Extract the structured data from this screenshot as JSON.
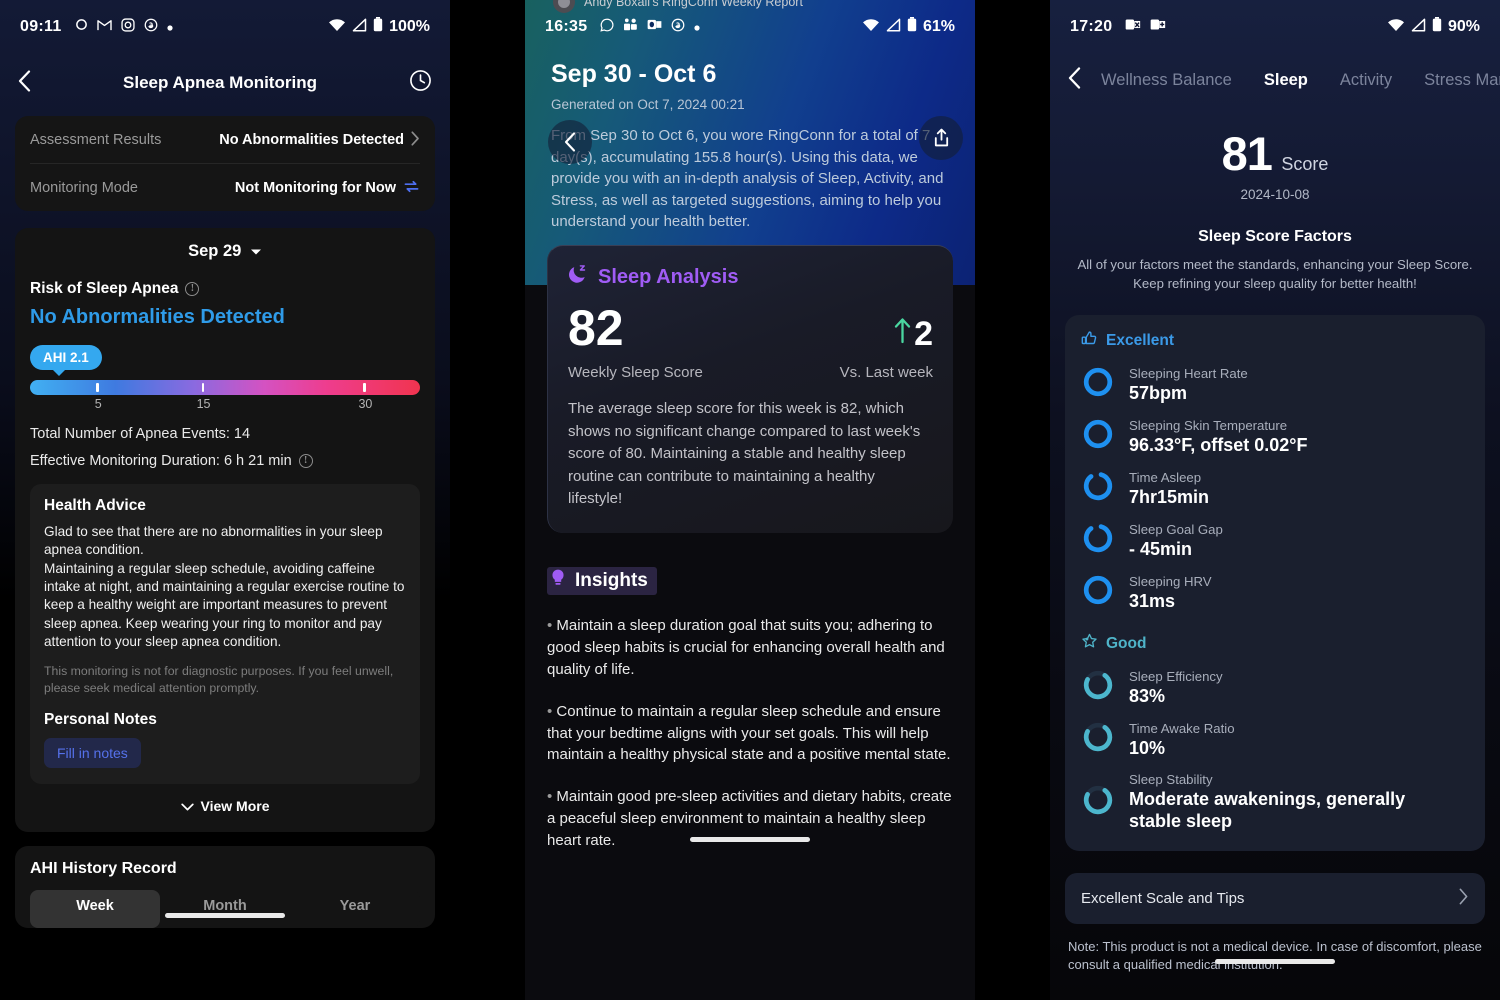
{
  "panel1": {
    "status": {
      "time": "09:11",
      "battery": "100%",
      "icons": [
        "circle-icon",
        "gmail-icon",
        "instagram-icon",
        "threads-icon",
        "dot-icon"
      ]
    },
    "nav": {
      "back": "‹",
      "title": "Sleep Apnea Monitoring",
      "right_icon": "clock-icon"
    },
    "summary_rows": [
      {
        "label": "Assessment Results",
        "value": "No Abnormalities Detected",
        "icon": "chevron-right-icon"
      },
      {
        "label": "Monitoring Mode",
        "value": "Not Monitoring for Now",
        "icon": "sync-icon"
      }
    ],
    "date_picker": "Sep 29",
    "risk_label": "Risk of Sleep Apnea",
    "risk_value": "No Abnormalities Detected",
    "ahi_badge": "AHI 2.1",
    "scale_ticks": [
      "5",
      "15",
      "30"
    ],
    "total_events": "Total Number of Apnea Events: 14",
    "duration": "Effective Monitoring Duration: 6 h 21 min",
    "advice_title": "Health Advice",
    "advice_body": "Glad to see that there are no abnormalities in your sleep apnea condition.\nMaintaining a regular sleep schedule, avoiding caffeine intake at night, and maintaining a regular exercise routine to keep a healthy weight are important measures to prevent sleep apnea. Keep wearing your ring to monitor and pay attention to your sleep apnea condition.",
    "disclaimer": "This monitoring is not for diagnostic purposes. If you feel unwell, please seek medical attention promptly.",
    "personal_notes_title": "Personal Notes",
    "fill_notes_button": "Fill in notes",
    "view_more": "View More",
    "history_title": "AHI History Record",
    "history_tabs": [
      "Week",
      "Month",
      "Year"
    ],
    "history_tab_active": "Week",
    "colors": {
      "accent_blue": "#2f9be8",
      "badge_blue": "#34a8ef",
      "notes_blue": "#5571ea"
    }
  },
  "panel2": {
    "notification": "Andy Boxall's RingConn Weekly Report",
    "status": {
      "time": "16:35",
      "battery": "61%",
      "icons": [
        "whatsapp-icon",
        "teams-icon",
        "outlook-icon",
        "threads-icon",
        "dot-icon"
      ]
    },
    "back_icon": "chevron-left-icon",
    "share_icon": "share-icon",
    "date_range": "Sep 30 - Oct 6",
    "generated": "Generated on Oct 7, 2024 00:21",
    "intro": "From Sep 30 to Oct 6, you wore RingConn for a total of 7 day(s), accumulating 155.8 hour(s). Using this data, we provide you with an in-depth analysis of Sleep, Activity, and Stress, as well as targeted suggestions, aiming to help you understand your health better.",
    "sleep_analysis": {
      "title": "Sleep Analysis",
      "icon": "moon-zzz-icon",
      "score": "82",
      "score_label": "Weekly Sleep Score",
      "delta": "2",
      "delta_icon": "arrow-up-icon",
      "delta_label": "Vs. Last week",
      "body": "The average sleep score for this week is 82, which shows no significant change compared to last week's score of 80. Maintaining a stable and healthy sleep routine can contribute to maintaining a healthy lifestyle!"
    },
    "insights": {
      "title": "Insights",
      "icon": "lightbulb-icon",
      "items": [
        "Maintain a sleep duration goal that suits you; adhering to good sleep habits is crucial for enhancing overall health and quality of life.",
        "Continue to maintain a regular sleep schedule and ensure that your bedtime aligns with your set goals. This will help maintain a healthy physical state and a positive mental state.",
        "Maintain good pre-sleep activities and dietary habits, create a peaceful sleep environment to maintain a healthy sleep heart rate."
      ]
    },
    "colors": {
      "purple": "#a05cf5",
      "green": "#4ad6a0"
    }
  },
  "panel3": {
    "status": {
      "time": "17:20",
      "battery": "90%",
      "icons": [
        "outlook-calendar-icon",
        "outlook-mail-icon"
      ]
    },
    "back_icon": "chevron-left-icon",
    "tabs": [
      "Wellness Balance",
      "Sleep",
      "Activity",
      "Stress Mar"
    ],
    "tab_active": "Sleep",
    "score": "81",
    "score_word": "Score",
    "score_date": "2024-10-08",
    "factors_title": "Sleep Score Factors",
    "factors_sub": "All of your factors meet the standards, enhancing your Sleep Score. Keep refining your sleep quality for better health!",
    "groups": [
      {
        "name": "Excellent",
        "icon": "thumbs-up-icon",
        "color": "#3b9ae8",
        "ring_color": "#1e90f0",
        "items": [
          {
            "label": "Sleeping Heart Rate",
            "value": "57bpm",
            "ring_pct": 100
          },
          {
            "label": "Sleeping Skin Temperature",
            "value": "96.33°F, offset 0.02°F",
            "ring_pct": 100
          },
          {
            "label": "Time Asleep",
            "value": "7hr15min",
            "ring_pct": 85
          },
          {
            "label": "Sleep Goal Gap",
            "value": "- 45min",
            "ring_pct": 85
          },
          {
            "label": "Sleeping HRV",
            "value": "31ms",
            "ring_pct": 100
          }
        ]
      },
      {
        "name": "Good",
        "icon": "star-badge-icon",
        "color": "#4fb4c9",
        "ring_color": "#4cb6cd",
        "items": [
          {
            "label": "Sleep Efficiency",
            "value": "83%",
            "ring_pct": 72
          },
          {
            "label": "Time Awake Ratio",
            "value": "10%",
            "ring_pct": 72
          },
          {
            "label": "Sleep Stability",
            "value": "Moderate awakenings, generally stable sleep",
            "ring_pct": 72
          }
        ]
      }
    ],
    "tips_row": "Excellent Scale and Tips",
    "tips_icon": "chevron-right-icon",
    "note": "Note: This product is not a medical device. In case of discomfort, please consult a qualified medical institution."
  }
}
